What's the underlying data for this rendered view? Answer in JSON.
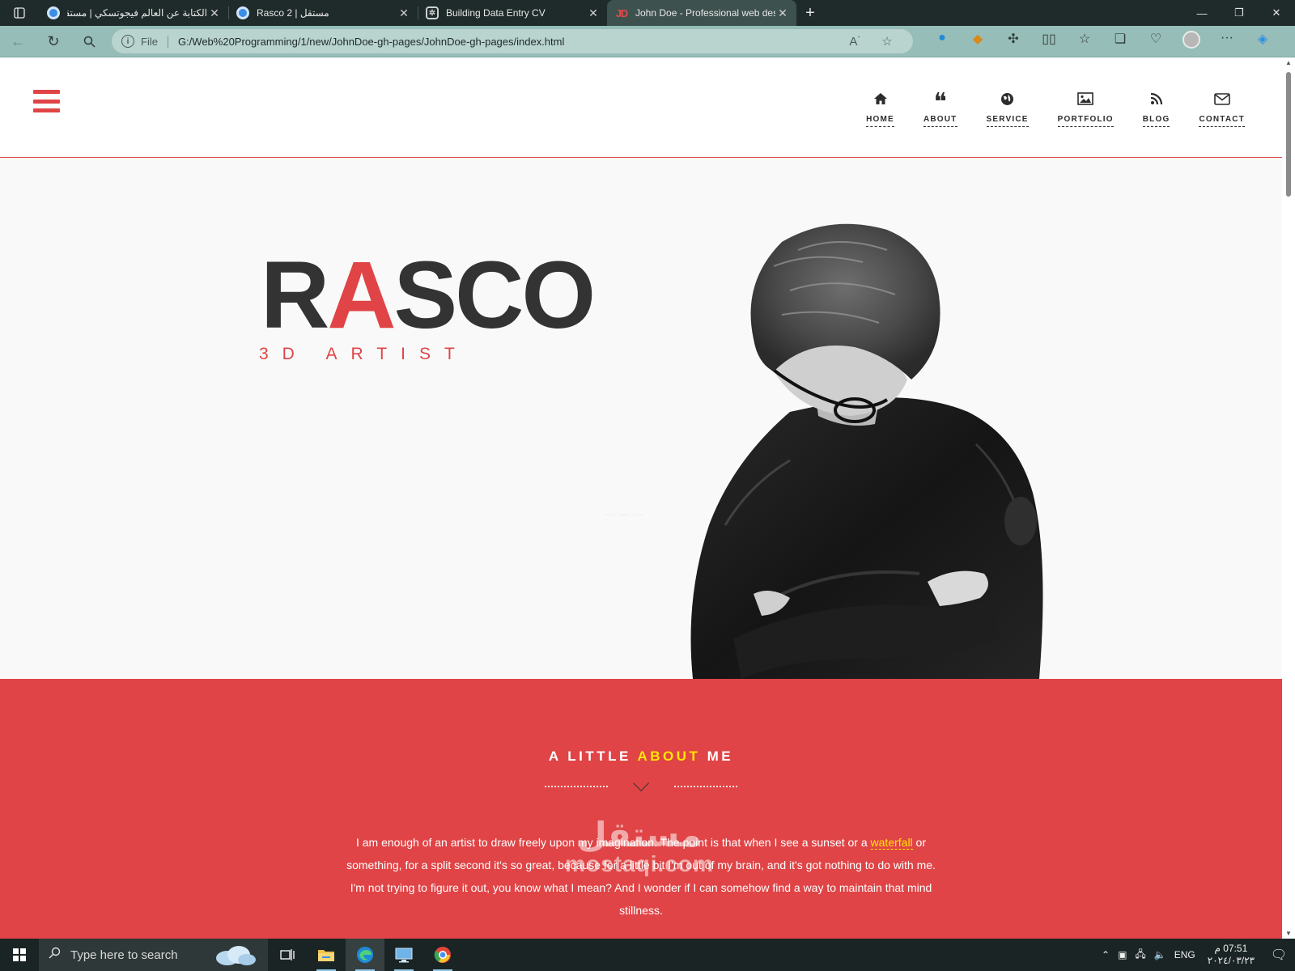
{
  "browser": {
    "tabs": [
      {
        "title": "الكتابة عن العالم فيجوتسكي | مستقل",
        "favicon": "circle-icon",
        "active": false
      },
      {
        "title": "Rasco 2 | مستقل",
        "favicon": "circle-icon",
        "active": false
      },
      {
        "title": "Building Data Entry CV",
        "favicon": "chatgpt-icon",
        "active": false
      },
      {
        "title": "John Doe - Professional web designer",
        "favicon": "jd-icon",
        "favicon_text": "JD",
        "active": true
      }
    ],
    "address": {
      "protocol_label": "File",
      "url": "G:/Web%20Programming/1/new/JohnDoe-gh-pages/JohnDoe-gh-pages/index.html"
    }
  },
  "site": {
    "nav": [
      {
        "label": "HOME",
        "icon": "home-icon"
      },
      {
        "label": "ABOUT",
        "icon": "quote-icon"
      },
      {
        "label": "SERVICE",
        "icon": "globe-icon"
      },
      {
        "label": "PORTFOLIO",
        "icon": "image-icon"
      },
      {
        "label": "BLOG",
        "icon": "rss-icon"
      },
      {
        "label": "CONTACT",
        "icon": "envelope-icon"
      }
    ],
    "hero": {
      "title_prefix": "R",
      "title_accent": "A",
      "title_suffix": "SCO",
      "subtitle": "3D ARTIST"
    },
    "about": {
      "heading_prefix": "A LITTLE ",
      "heading_highlight": "ABOUT",
      "heading_suffix": " ME",
      "text_before_link": "I am enough of an artist to draw freely upon my imagination. The point is that when I see a sunset or a ",
      "link_text": "waterfall",
      "text_after_link": " or something, for a split second it's so great, because for a little bit I'm out of my brain, and it's got nothing to do with me. I'm not trying to figure it out, you know what I mean? And I wonder if I can somehow find a way to maintain that mind stillness."
    },
    "colors": {
      "accent": "#e04446",
      "highlight": "#ffe600",
      "dark": "#333333"
    }
  },
  "watermark": {
    "arabic": "مستقل",
    "latin": "mostaqi.com"
  },
  "taskbar": {
    "search_placeholder": "Type here to search",
    "apps": [
      "task-view-icon",
      "file-explorer-icon",
      "edge-icon",
      "remote-desktop-icon",
      "chrome-icon"
    ],
    "language": "ENG",
    "time": "07:51 م",
    "date": "٢٠٢٤/٠٣/٢٣"
  }
}
